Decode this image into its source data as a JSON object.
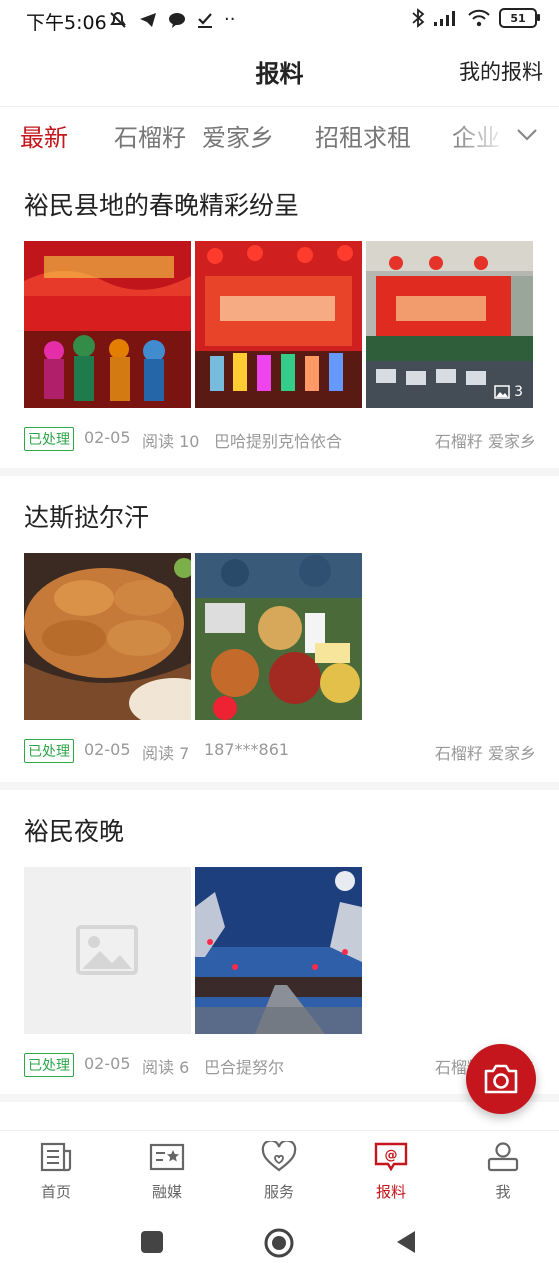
{
  "status_bar": {
    "time": "下午5:06",
    "battery": "51"
  },
  "header": {
    "title": "报料",
    "action": "我的报料"
  },
  "tabs": [
    {
      "label": "最新"
    },
    {
      "label": "石榴籽"
    },
    {
      "label": "爱家乡"
    },
    {
      "label": "招租求租"
    },
    {
      "label": "企业"
    }
  ],
  "posts": [
    {
      "title": "裕民县地的春晚精彩纷呈",
      "image_count": "3",
      "status": "已处理",
      "date": "02-05",
      "read": "阅读 10",
      "author": "巴哈提别克恰依合",
      "tags": "石榴籽  爱家乡"
    },
    {
      "title": "达斯挞尔汗",
      "status": "已处理",
      "date": "02-05",
      "read": "阅读 7",
      "author": "187***861",
      "tags": "石榴籽  爱家乡"
    },
    {
      "title": "裕民夜晚",
      "status": "已处理",
      "date": "02-05",
      "read": "阅读 6",
      "author": "巴合提努尔",
      "tags": "石榴籽  爱家乡"
    }
  ],
  "bottom_nav": [
    {
      "label": "首页",
      "icon": "news-icon"
    },
    {
      "label": "融媒",
      "icon": "media-card-icon"
    },
    {
      "label": "服务",
      "icon": "heart-icon"
    },
    {
      "label": "报料",
      "icon": "report-chat-icon"
    },
    {
      "label": "我",
      "icon": "user-icon"
    }
  ],
  "colors": {
    "accent": "#c4161c",
    "processed": "#2ea64a"
  }
}
